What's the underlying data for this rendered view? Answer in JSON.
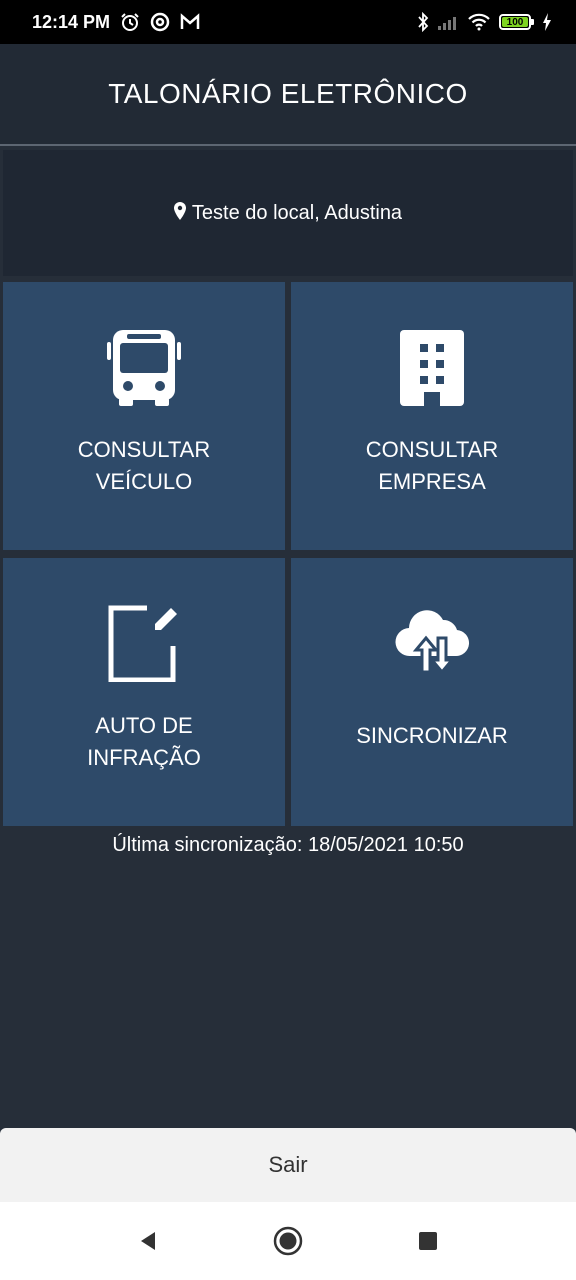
{
  "status_bar": {
    "time": "12:14 PM",
    "battery": "100",
    "icons": [
      "alarm-icon",
      "at-icon",
      "gmail-icon",
      "bluetooth-icon",
      "signal-icon",
      "wifi-icon",
      "battery-icon",
      "charging-icon"
    ]
  },
  "header": {
    "title": "TALONÁRIO ELETRÔNICO"
  },
  "location": {
    "icon": "map-pin-icon",
    "text": "Teste do local, Adustina"
  },
  "tiles": [
    {
      "label": "CONSULTAR\nVEÍCULO",
      "icon": "bus-icon"
    },
    {
      "label": "CONSULTAR\nEMPRESA",
      "icon": "building-icon"
    },
    {
      "label": "AUTO DE\nINFRAÇÃO",
      "icon": "edit-icon"
    },
    {
      "label": "SINCRONIZAR",
      "icon": "cloud-sync-icon"
    }
  ],
  "last_sync": "Última sincronização: 18/05/2021 10:50",
  "exit_button": "Sair",
  "nav": [
    "back-icon",
    "home-icon",
    "recents-icon"
  ],
  "colors": {
    "background": "#262e39",
    "header": "#222a35",
    "tile": "#2e4a69",
    "battery": "#7ed321"
  }
}
